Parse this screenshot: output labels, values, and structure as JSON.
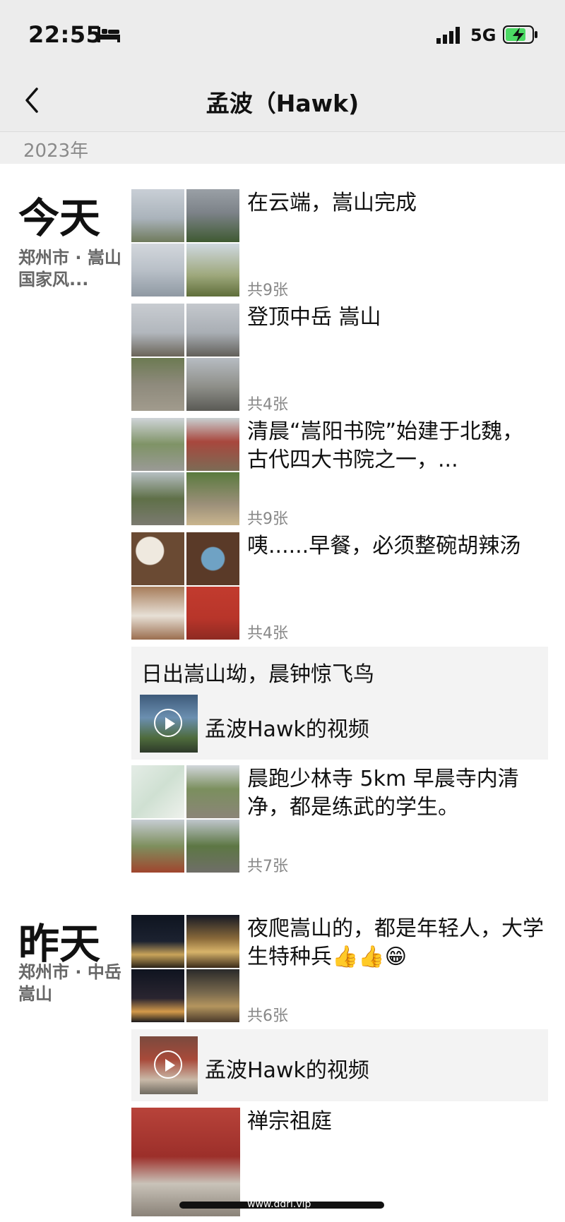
{
  "status": {
    "time": "22:55",
    "network": "5G"
  },
  "nav": {
    "title": "孟波（Hawk)"
  },
  "year": "2023年",
  "days": [
    {
      "label": "今天",
      "location": "郑州市 · 嵩山国家风..."
    },
    {
      "label": "昨天",
      "location": "郑州市 · 中岳嵩山"
    }
  ],
  "posts": [
    {
      "text": "在云端，嵩山完成",
      "count": "共9张"
    },
    {
      "text": "登顶中岳 嵩山",
      "count": "共4张"
    },
    {
      "text": "清晨“嵩阳书院”始建于北魏，古代四大书院之一，...",
      "count": "共9张"
    },
    {
      "text": "咦......早餐，必须整碗胡辣汤",
      "count": "共4张"
    },
    {
      "text": "晨跑少林寺 5km 早晨寺内清净，都是练武的学生。",
      "count": "共7张"
    },
    {
      "text": "夜爬嵩山的，都是年轻人，大学生特种兵👍👍😁",
      "count": "共6张"
    },
    {
      "text": "禅宗祖庭",
      "count": ""
    }
  ],
  "videos": [
    {
      "caption": "日出嵩山坳，晨钟惊飞鸟",
      "label": "孟波Hawk的视频"
    },
    {
      "caption": "",
      "label": "孟波Hawk的视频"
    }
  ],
  "watermark": "www.ddri.vip",
  "colors": {
    "bar_bg": "#ececec",
    "video_card_bg": "#f3f3f3",
    "battery": "#4cd964"
  }
}
